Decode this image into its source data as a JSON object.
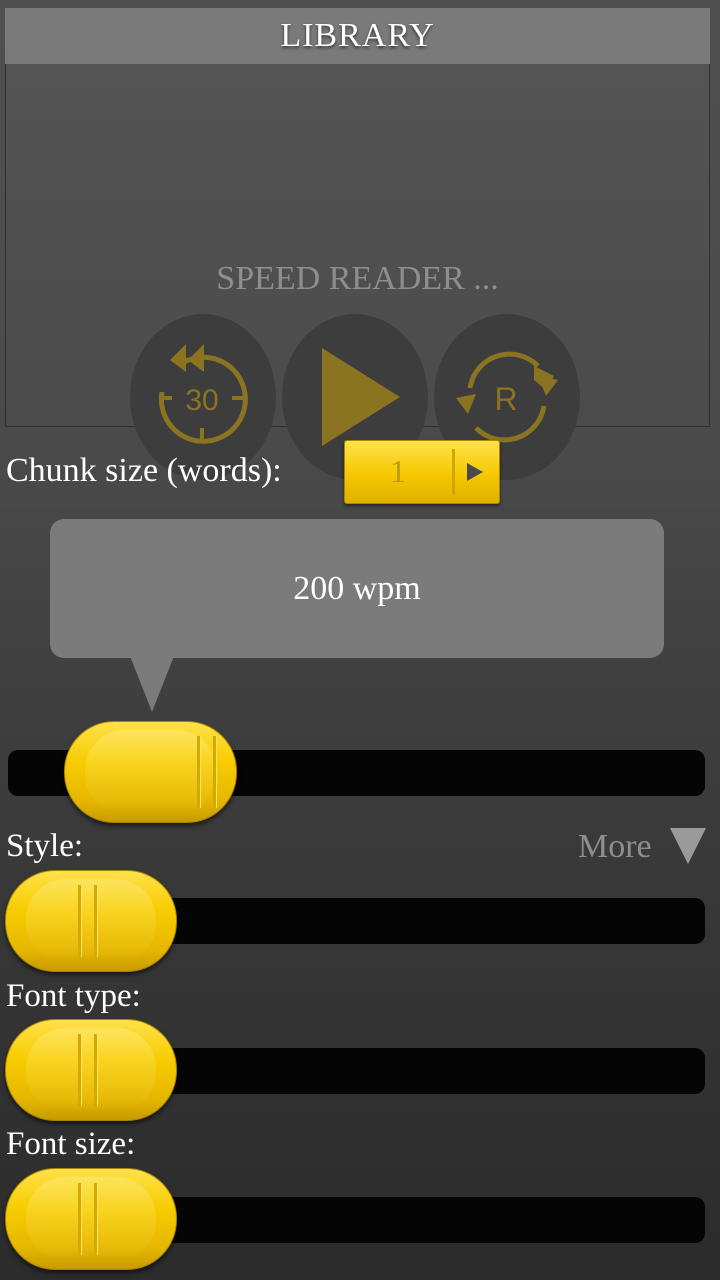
{
  "header": {
    "library_label": "LIBRARY"
  },
  "player": {
    "title": "SPEED READER ...",
    "rewind_label": "30",
    "restart_label": "R"
  },
  "chunk": {
    "label": "Chunk size (words):",
    "value": "1"
  },
  "speed": {
    "display": "200 wpm",
    "level": 0.2
  },
  "style": {
    "label": "Style:",
    "more_label": "More"
  },
  "font_type": {
    "label": "Font type:"
  },
  "font_size": {
    "label": "Font size:"
  },
  "colors": {
    "accent": "#f5c800",
    "icon_gold": "#8a7421",
    "panel": "#4b4b4b",
    "track": "#050505"
  },
  "icons": [
    "rewind-30-icon",
    "play-icon",
    "restart-icon",
    "chevron-right-icon",
    "more-triangle-icon"
  ]
}
